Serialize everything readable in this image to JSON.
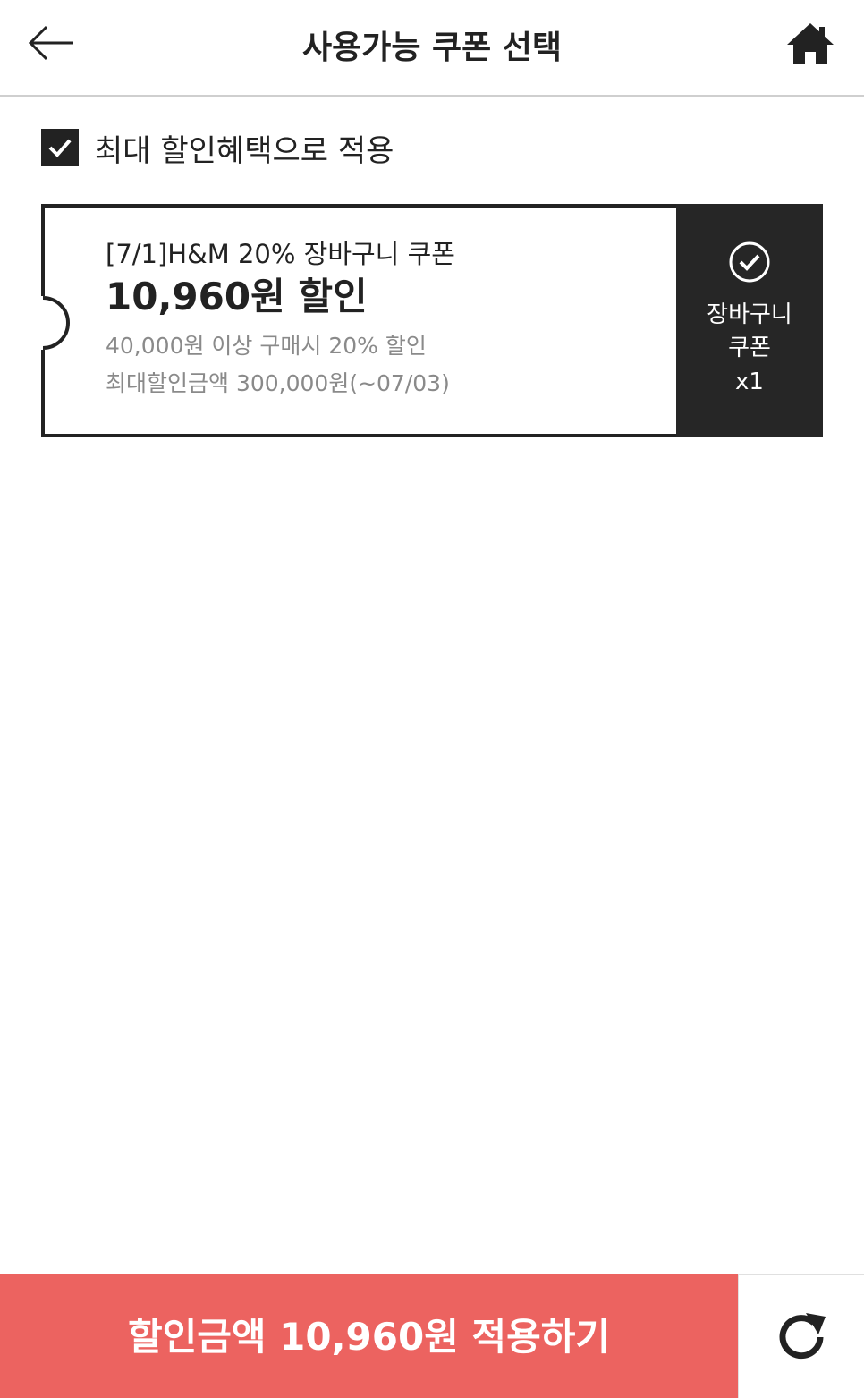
{
  "header": {
    "title": "사용가능 쿠폰 선택",
    "back_icon": "arrow-left-icon",
    "home_icon": "home-icon"
  },
  "max_discount": {
    "label": "최대 할인혜택으로 적용",
    "checked": true
  },
  "coupons": [
    {
      "name": "[7/1]H&M 20% 장바구니 쿠폰",
      "amount": "10,960원 할인",
      "condition": "40,000원 이상 구매시 20% 할인",
      "max_and_expiry": "최대할인금액 300,000원(~07/03)",
      "type_line1": "장바구니",
      "type_line2": "쿠폰",
      "count": "x1",
      "selected": true
    }
  ],
  "footer": {
    "apply_label": "할인금액 10,960원 적용하기",
    "refresh_icon": "refresh-icon"
  },
  "colors": {
    "primary_dark": "#222222",
    "accent_red": "#ec6360",
    "muted_text": "#8a8a8a",
    "divider": "#cfcfcf"
  }
}
